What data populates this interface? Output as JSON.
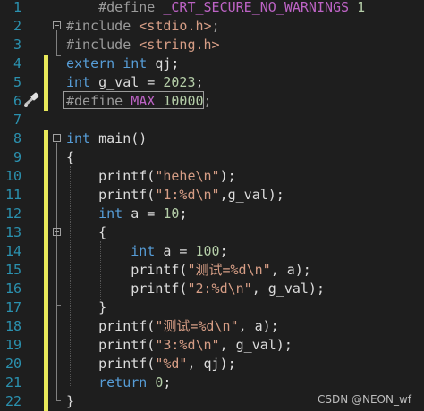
{
  "editor": {
    "lines": [
      {
        "num": "1",
        "segs": [
          [
            "pp",
            "    #define "
          ],
          [
            "mac",
            "_CRT_SECURE_NO_WARNINGS"
          ],
          [
            "nm",
            " 1"
          ]
        ]
      },
      {
        "num": "2",
        "segs": [
          [
            "pp",
            "#include "
          ],
          [
            "st",
            "<stdio.h>"
          ],
          [
            "pp",
            ";"
          ]
        ]
      },
      {
        "num": "3",
        "segs": [
          [
            "pp",
            "#include "
          ],
          [
            "st",
            "<string.h>"
          ]
        ]
      },
      {
        "num": "4",
        "segs": [
          [
            "kw",
            "extern"
          ],
          [
            "tx",
            " "
          ],
          [
            "kw",
            "int"
          ],
          [
            "tx",
            " qj;"
          ]
        ]
      },
      {
        "num": "5",
        "segs": [
          [
            "kw",
            "int"
          ],
          [
            "tx",
            " g_val = "
          ],
          [
            "nm",
            "2023"
          ],
          [
            "tx",
            ";"
          ]
        ]
      },
      {
        "num": "6",
        "segs": [
          [
            "pp",
            "#define "
          ],
          [
            "mac",
            "MAX"
          ],
          [
            "nm",
            " 10000"
          ],
          [
            "pp",
            ";"
          ]
        ]
      },
      {
        "num": "7",
        "segs": []
      },
      {
        "num": "8",
        "segs": [
          [
            "kw",
            "int"
          ],
          [
            "tx",
            " main()"
          ]
        ]
      },
      {
        "num": "9",
        "segs": [
          [
            "tx",
            "{"
          ]
        ]
      },
      {
        "num": "10",
        "segs": [
          [
            "tx",
            "    printf("
          ],
          [
            "st",
            "\"hehe\\n\""
          ],
          [
            "tx",
            ");"
          ]
        ]
      },
      {
        "num": "11",
        "segs": [
          [
            "tx",
            "    printf("
          ],
          [
            "st",
            "\"1:%d\\n\""
          ],
          [
            "tx",
            ",g_val);"
          ]
        ]
      },
      {
        "num": "12",
        "segs": [
          [
            "tx",
            "    "
          ],
          [
            "kw",
            "int"
          ],
          [
            "tx",
            " a = "
          ],
          [
            "nm",
            "10"
          ],
          [
            "tx",
            ";"
          ]
        ]
      },
      {
        "num": "13",
        "segs": [
          [
            "tx",
            "    {"
          ]
        ]
      },
      {
        "num": "14",
        "segs": [
          [
            "tx",
            "        "
          ],
          [
            "kw",
            "int"
          ],
          [
            "tx",
            " a = "
          ],
          [
            "nm",
            "100"
          ],
          [
            "tx",
            ";"
          ]
        ]
      },
      {
        "num": "15",
        "segs": [
          [
            "tx",
            "        printf("
          ],
          [
            "st",
            "\"测试=%d\\n\""
          ],
          [
            "tx",
            ", a);"
          ]
        ]
      },
      {
        "num": "16",
        "segs": [
          [
            "tx",
            "        printf("
          ],
          [
            "st",
            "\"2:%d\\n\""
          ],
          [
            "tx",
            ", g_val);"
          ]
        ]
      },
      {
        "num": "17",
        "segs": [
          [
            "tx",
            "    }"
          ]
        ]
      },
      {
        "num": "18",
        "segs": [
          [
            "tx",
            "    printf("
          ],
          [
            "st",
            "\"测试=%d\\n\""
          ],
          [
            "tx",
            ", a);"
          ]
        ]
      },
      {
        "num": "19",
        "segs": [
          [
            "tx",
            "    printf("
          ],
          [
            "st",
            "\"3:%d\\n\""
          ],
          [
            "tx",
            ", g_val);"
          ]
        ]
      },
      {
        "num": "20",
        "segs": [
          [
            "tx",
            "    printf("
          ],
          [
            "st",
            "\"%d\""
          ],
          [
            "tx",
            ", qj);"
          ]
        ]
      },
      {
        "num": "21",
        "segs": [
          [
            "tx",
            "    "
          ],
          [
            "kw",
            "return"
          ],
          [
            "tx",
            " "
          ],
          [
            "nm",
            "0"
          ],
          [
            "tx",
            ";"
          ]
        ]
      },
      {
        "num": "22",
        "segs": [
          [
            "tx",
            "}"
          ]
        ]
      }
    ],
    "changed_lines": [
      "4",
      "5",
      "6",
      "8",
      "9",
      "10",
      "11",
      "12",
      "13",
      "14",
      "15",
      "16",
      "17",
      "18",
      "19",
      "20",
      "21",
      "22"
    ],
    "fold_lines": [
      "2",
      "8",
      "13"
    ],
    "gutter_icon": "hammer-icon"
  },
  "watermark": "CSDN @NEON_wf",
  "colors": {
    "background": "#1e1e1e",
    "line_number": "#2b91af",
    "keyword": "#569cd6",
    "preprocessor": "#9b9b9b",
    "string": "#d69d85",
    "number": "#b5cea8",
    "macro": "#bd63c5",
    "change_bar": "#e8e85a"
  }
}
